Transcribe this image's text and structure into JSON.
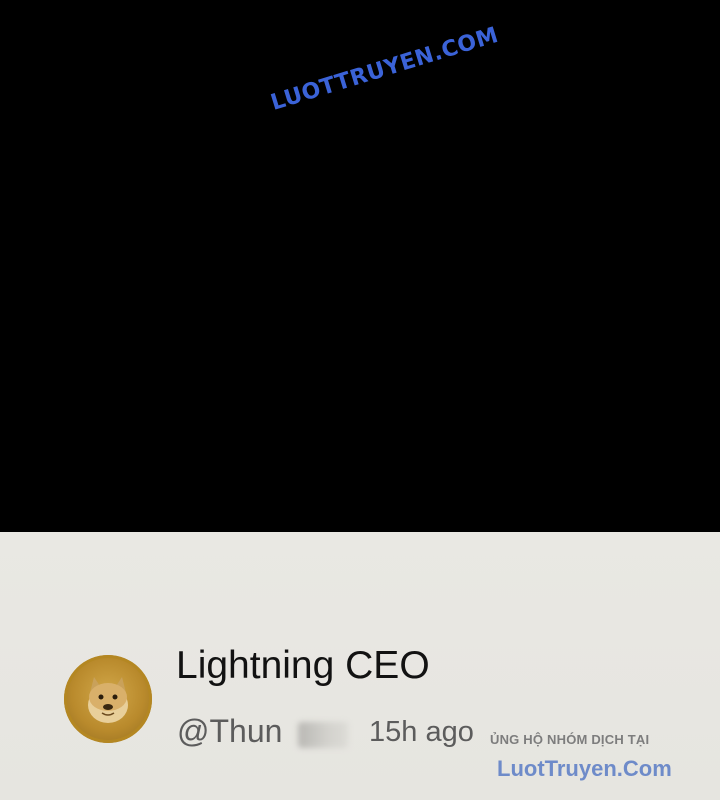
{
  "watermark_top": "LUOTTRUYEN.COM",
  "comment": {
    "display_name": "Lightning CEO",
    "handle_prefix": "@Thun",
    "time_ago": "15h ago"
  },
  "watermark_bottom": {
    "line1": "ỦNG HỘ NHÓM DỊCH TẠI",
    "line2": "LuotTruyen.Com"
  },
  "avatar_icon": "doge-avatar-icon",
  "colors": {
    "watermark_blue": "#3b63d8",
    "panel_bg": "#e8e7e2",
    "top_area": "#000000"
  }
}
